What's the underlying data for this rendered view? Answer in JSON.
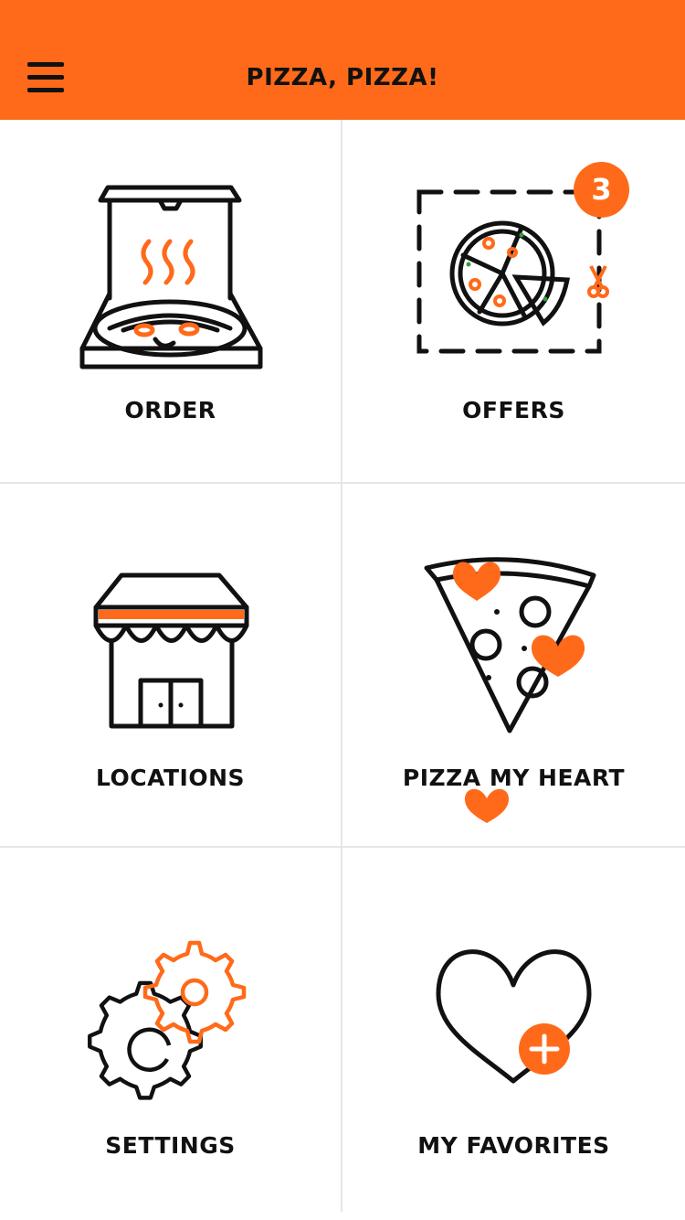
{
  "header": {
    "title": "PIZZA, PIZZA!",
    "menu_icon": "hamburger-menu-icon",
    "background": "#ff6a1a"
  },
  "tiles": [
    {
      "label": "ORDER",
      "icon": "pizza-box-icon"
    },
    {
      "label": "OFFERS",
      "icon": "coupon-pizza-icon",
      "badge": "3"
    },
    {
      "label": "LOCATIONS",
      "icon": "storefront-icon"
    },
    {
      "label": "PIZZA MY HEART",
      "icon": "pizza-slice-hearts-icon"
    },
    {
      "label": "SETTINGS",
      "icon": "gears-icon"
    },
    {
      "label": "MY FAVORITES",
      "icon": "heart-plus-icon"
    }
  ],
  "colors": {
    "accent": "#ff6a1a",
    "ink": "#111111",
    "divider": "#e6e6e6"
  }
}
